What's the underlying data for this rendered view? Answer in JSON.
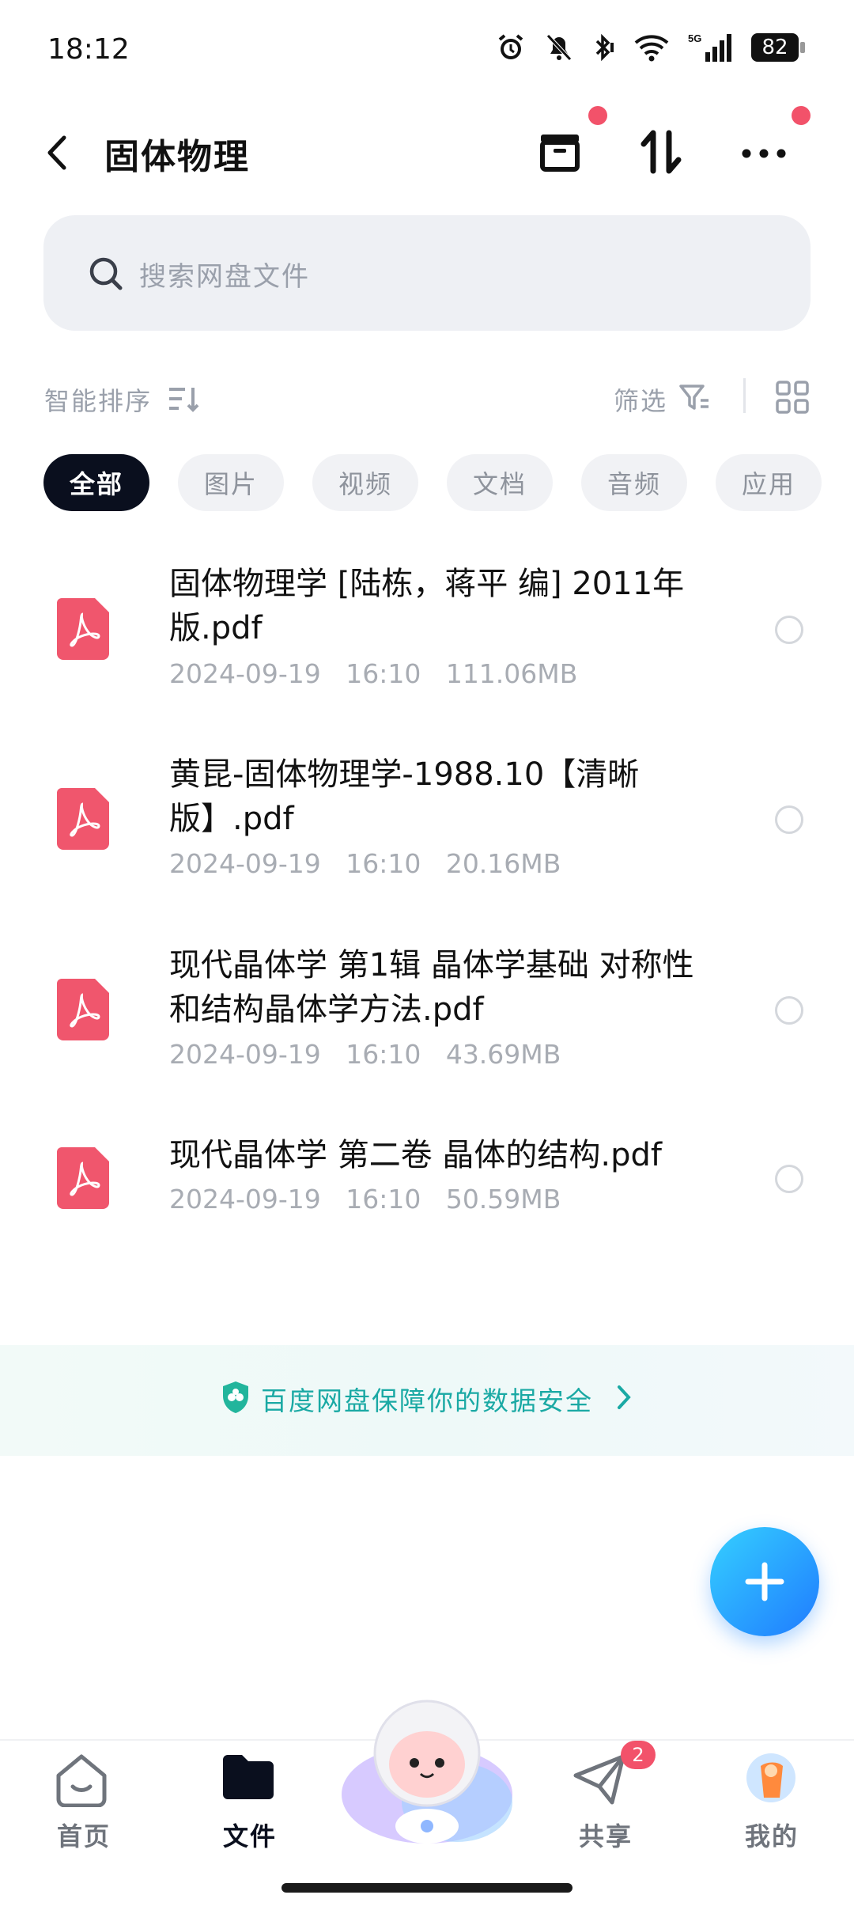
{
  "status_bar": {
    "time": "18:12",
    "battery": "82"
  },
  "header": {
    "title": "固体物理"
  },
  "search": {
    "placeholder": "搜索网盘文件"
  },
  "toolbar": {
    "sort_label": "智能排序",
    "filter_label": "筛选"
  },
  "tabs": [
    {
      "label": "全部",
      "active": true
    },
    {
      "label": "图片"
    },
    {
      "label": "视频"
    },
    {
      "label": "文档"
    },
    {
      "label": "音频"
    },
    {
      "label": "应用"
    }
  ],
  "files": [
    {
      "name": "固体物理学 [陆栋，蒋平 编] 2011年版.pdf",
      "meta": "2024-09-19   16:10   111.06MB"
    },
    {
      "name": "黄昆-固体物理学-1988.10【清晰版】.pdf",
      "meta": "2024-09-19   16:10   20.16MB"
    },
    {
      "name": "现代晶体学 第1辑 晶体学基础 对称性和结构晶体学方法.pdf",
      "meta": "2024-09-19   16:10   43.69MB"
    },
    {
      "name": "现代晶体学 第二卷 晶体的结构.pdf",
      "meta": "2024-09-19   16:10   50.59MB"
    }
  ],
  "banner": {
    "text": "百度网盘保障你的数据安全"
  },
  "bottom_nav": {
    "home": "首页",
    "files": "文件",
    "share": "共享",
    "share_badge": "2",
    "mine": "我的"
  },
  "colors": {
    "accent": "#1f7bff",
    "pdf_red": "#f0566d",
    "badge_red": "#f2526a",
    "active_tab": "#0a0f1e"
  }
}
